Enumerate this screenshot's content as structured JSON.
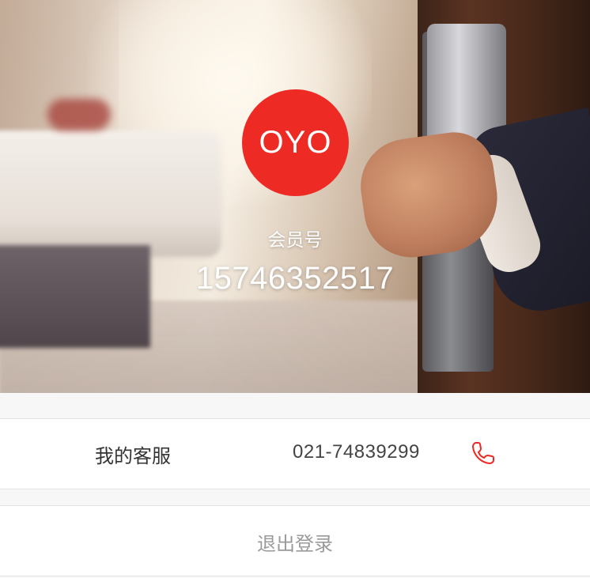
{
  "profile": {
    "logo_text": "OYO",
    "member_label": "会员号",
    "member_number": "15746352517"
  },
  "service": {
    "label": "我的客服",
    "phone": "021-74839299",
    "icon": "phone-icon"
  },
  "logout": {
    "label": "退出登录"
  },
  "colors": {
    "brand": "#ee2a24",
    "background": "#f7f7f7",
    "text_primary": "#333333",
    "text_muted": "#9a9a9a"
  }
}
